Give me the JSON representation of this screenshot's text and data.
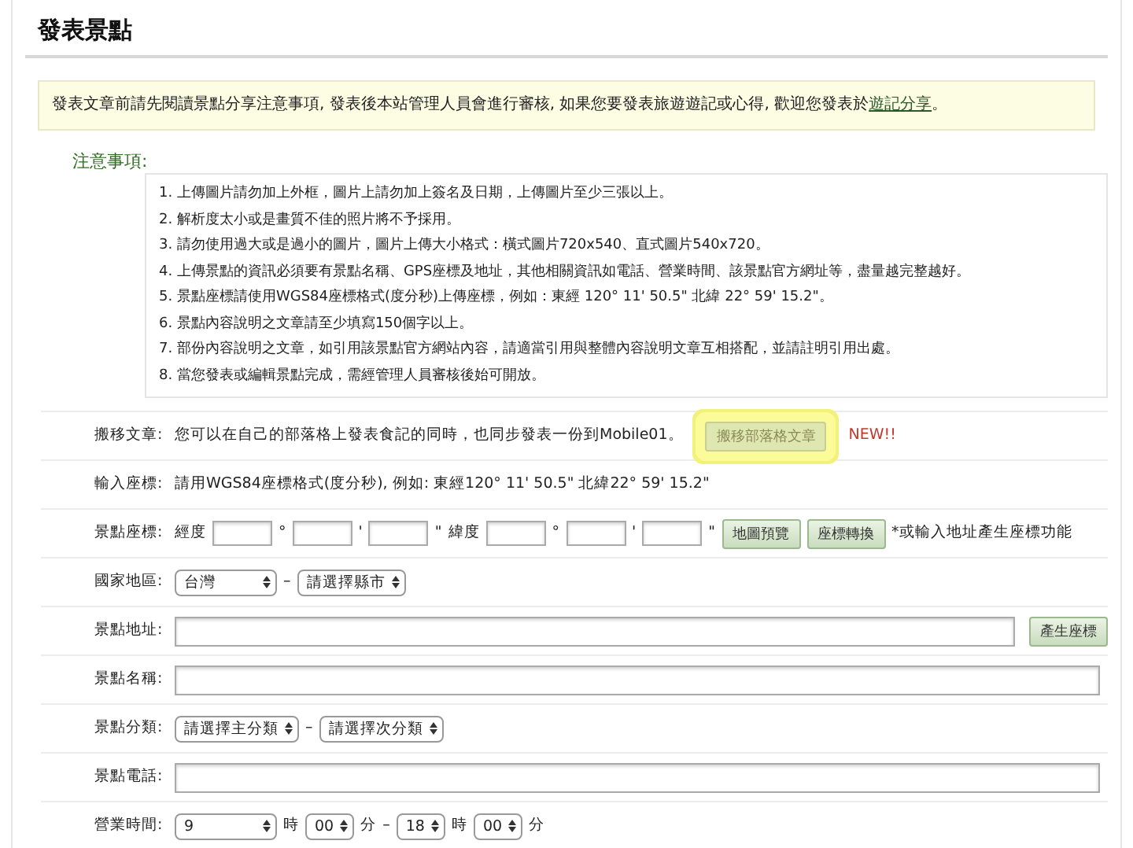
{
  "title": "發表景點",
  "notice": {
    "text": "發表文章前請先閱讀景點分享注意事項, 發表後本站管理人員會進行審核, 如果您要發表旅遊遊記或心得, 歡迎您發表於",
    "link": "遊記分享",
    "end": "。"
  },
  "notes": {
    "label": "注意事項:",
    "items": [
      "1. 上傳圖片請勿加上外框，圖片上請勿加上簽名及日期，上傳圖片至少三張以上。",
      "2. 解析度太小或是畫質不佳的照片將不予採用。",
      "3. 請勿使用過大或是過小的圖片，圖片上傳大小格式：橫式圖片720x540、直式圖片540x720。",
      "4. 上傳景點的資訊必須要有景點名稱、GPS座標及地址，其他相關資訊如電話、營業時間、該景點官方網址等，盡量越完整越好。",
      "5. 景點座標請使用WGS84座標格式(度分秒)上傳座標，例如：東經 120° 11' 50.5\" 北緯 22° 59' 15.2\"。",
      "6. 景點內容說明之文章請至少填寫150個字以上。",
      "7. 部份內容說明之文章，如引用該景點官方網站內容，請適當引用與整體內容說明文章互相搭配，並請註明引用出處。",
      "8. 當您發表或編輯景點完成，需經管理人員審核後始可開放。"
    ]
  },
  "rows": [
    {
      "label": "搬移文章:",
      "parts": [
        {
          "kind": "text",
          "text": "您可以在自己的部落格上發表食記的同時，也同步發表一份到Mobile01。"
        },
        {
          "kind": "button",
          "text": "搬移部落格文章",
          "highlighted": true
        },
        {
          "kind": "badge",
          "text": "NEW!!"
        }
      ]
    },
    {
      "label": "輸入座標:",
      "parts": [
        {
          "kind": "text",
          "text": "請用WGS84座標格式(度分秒), 例如: 東經120° 11' 50.5\" 北緯22° 59' 15.2\""
        }
      ]
    },
    {
      "label": "景點座標:",
      "parts": [
        {
          "kind": "text",
          "text": "經度"
        },
        {
          "kind": "input"
        },
        {
          "kind": "text",
          "text": "°"
        },
        {
          "kind": "input"
        },
        {
          "kind": "text",
          "text": "'"
        },
        {
          "kind": "input"
        },
        {
          "kind": "text",
          "text": "\""
        },
        {
          "kind": "text",
          "text": "緯度"
        },
        {
          "kind": "input"
        },
        {
          "kind": "text",
          "text": "°"
        },
        {
          "kind": "input"
        },
        {
          "kind": "text",
          "text": "'"
        },
        {
          "kind": "input"
        },
        {
          "kind": "text",
          "text": "\""
        },
        {
          "kind": "button",
          "text": "地圖預覽",
          "highlighted": false
        },
        {
          "kind": "button",
          "text": "座標轉換",
          "highlighted": false
        },
        {
          "kind": "text",
          "text": "*或輸入地址產生座標功能"
        }
      ]
    },
    {
      "label": "國家地區:",
      "parts": [
        {
          "kind": "select",
          "text": "台灣"
        },
        {
          "kind": "text",
          "text": "–"
        },
        {
          "kind": "select",
          "text": "請選擇縣市"
        }
      ]
    },
    {
      "label": "景點地址:",
      "parts": [
        {
          "kind": "input"
        },
        {
          "kind": "button",
          "text": "產生座標",
          "highlighted": false
        }
      ]
    },
    {
      "label": "景點名稱:",
      "parts": [
        {
          "kind": "input"
        }
      ]
    },
    {
      "label": "景點分類:",
      "parts": [
        {
          "kind": "select",
          "text": "請選擇主分類"
        },
        {
          "kind": "text",
          "text": "–"
        },
        {
          "kind": "select",
          "text": "請選擇次分類"
        }
      ]
    },
    {
      "label": "景點電話:",
      "parts": [
        {
          "kind": "input"
        }
      ]
    },
    {
      "label": "營業時間:",
      "parts": [
        {
          "kind": "select",
          "text": "9"
        },
        {
          "kind": "text",
          "text": "時"
        },
        {
          "kind": "select",
          "text": "00"
        },
        {
          "kind": "text",
          "text": "分"
        },
        {
          "kind": "text",
          "text": "–"
        },
        {
          "kind": "select",
          "text": "18"
        },
        {
          "kind": "text",
          "text": "時"
        },
        {
          "kind": "select",
          "text": "00"
        },
        {
          "kind": "text",
          "text": "分"
        }
      ]
    }
  ]
}
